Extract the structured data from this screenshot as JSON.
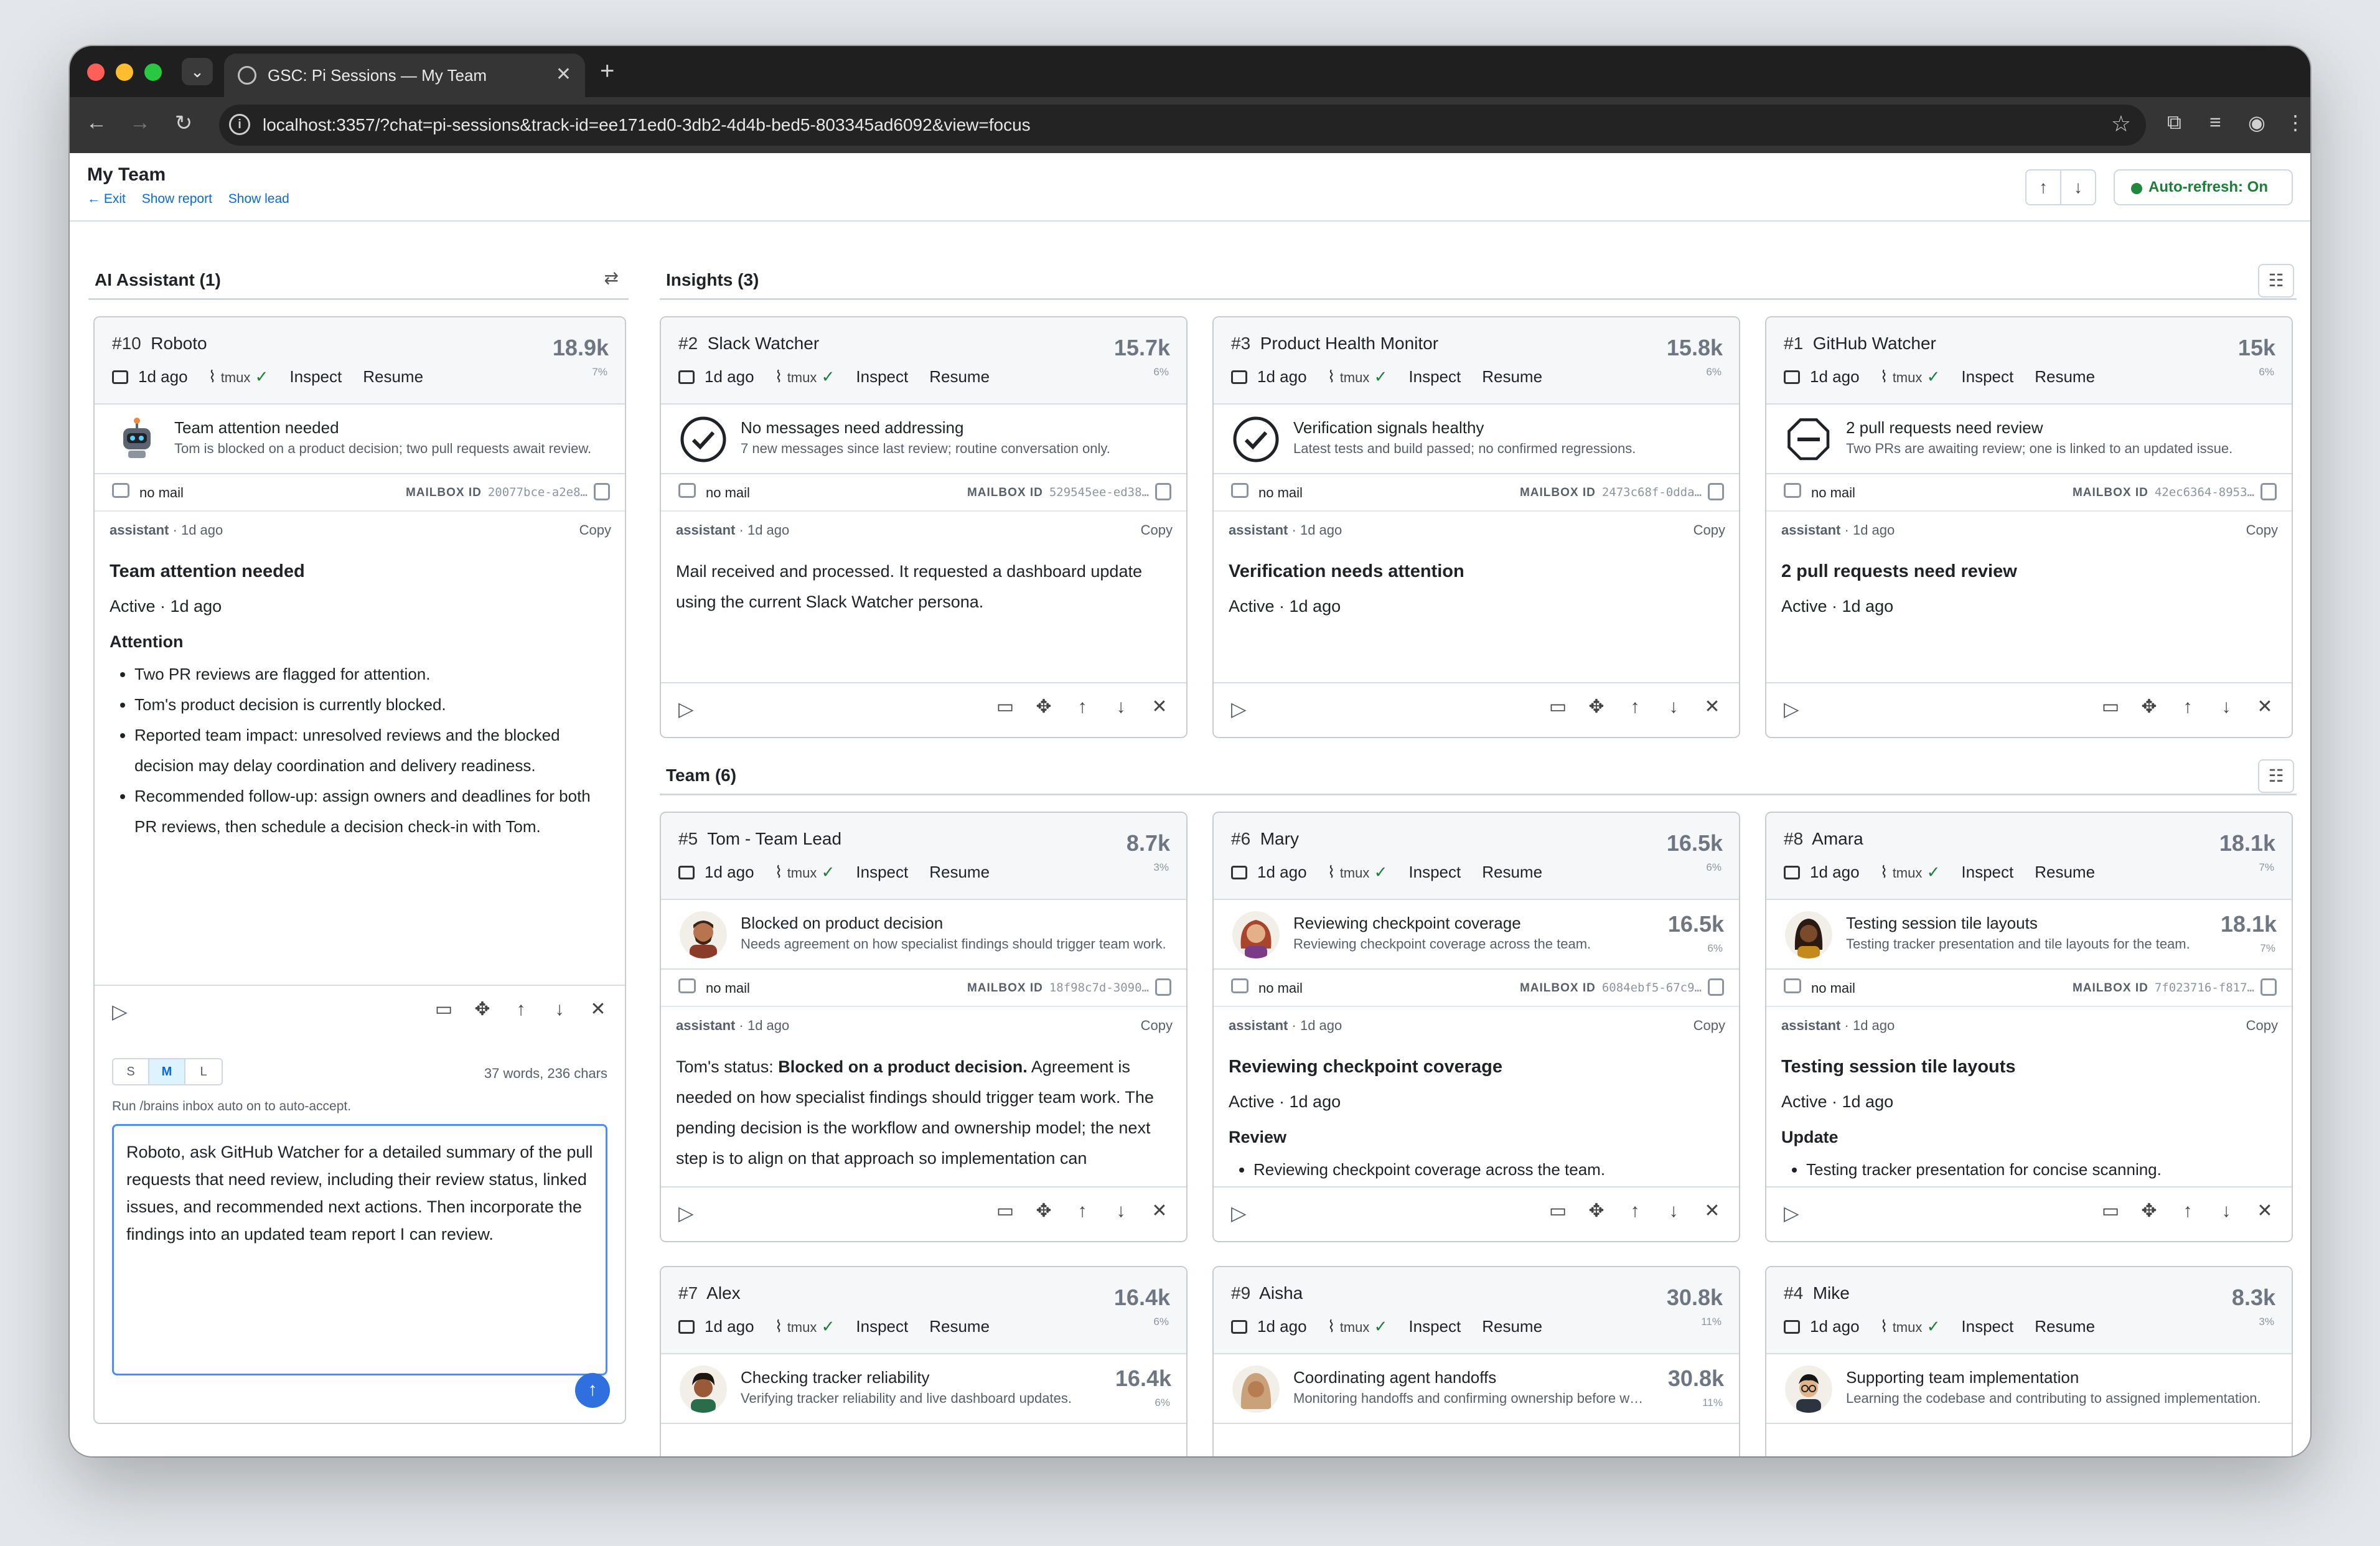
{
  "browser": {
    "tab_title": "GSC: Pi Sessions — My Team",
    "url": "localhost:3357/?chat=pi-sessions&track-id=ee171ed0-3db2-4d4b-bed5-803345ad6092&view=focus"
  },
  "page": {
    "title": "My Team",
    "links": [
      "← Exit",
      "Show report",
      "Show lead"
    ],
    "auto_refresh": "Auto-refresh: On"
  },
  "sections": {
    "assistant": "AI Assistant (1)",
    "insights": "Insights (3)",
    "team": "Team (6)"
  },
  "common": {
    "ago": "1d ago",
    "tmux": "tmux",
    "inspect": "Inspect",
    "resume": "Resume",
    "no_mail": "no mail",
    "mailbox_label": "MAILBOX ID",
    "assistant": "assistant",
    "assistant_ago": "· 1d ago",
    "copy": "Copy"
  },
  "cards": [
    {
      "num": "#10",
      "name": "Roboto",
      "tokens": "18.9k",
      "pct": "7%",
      "status_title": "Team attention needed",
      "status_sub": "Tom is blocked on a product decision; two pull requests await review.",
      "mailbox_id": "20077bce-a2e8…",
      "heading": "Team attention needed",
      "state": "Active · 1d ago",
      "section": "Attention",
      "bullets": [
        "Two PR reviews are flagged for attention.",
        "Tom's product decision is currently blocked.",
        "Reported team impact: unresolved reviews and the blocked decision may delay coordination and delivery readiness.",
        "Recommended follow-up: assign owners and deadlines for both PR reviews, then schedule a decision check-in with Tom."
      ]
    },
    {
      "num": "#2",
      "name": "Slack Watcher",
      "tokens": "15.7k",
      "pct": "6%",
      "status_title": "No messages need addressing",
      "status_sub": "7 new messages since last review; routine conversation only.",
      "mailbox_id": "529545ee-ed38…",
      "text": "Mail received and processed. It requested a dashboard update using the current Slack Watcher persona."
    },
    {
      "num": "#3",
      "name": "Product Health Monitor",
      "tokens": "15.8k",
      "pct": "6%",
      "status_title": "Verification signals healthy",
      "status_sub": "Latest tests and build passed; no confirmed regressions.",
      "mailbox_id": "2473c68f-0dda…",
      "heading": "Verification needs attention",
      "state": "Active · 1d ago"
    },
    {
      "num": "#1",
      "name": "GitHub Watcher",
      "tokens": "15k",
      "pct": "6%",
      "status_title": "2 pull requests need review",
      "status_sub": "Two PRs are awaiting review; one is linked to an updated issue.",
      "mailbox_id": "42ec6364-8953…",
      "heading": "2 pull requests need review",
      "state": "Active · 1d ago"
    },
    {
      "num": "#5",
      "name": "Tom - Team Lead",
      "tokens": "8.7k",
      "pct": "3%",
      "status_title": "Blocked on product decision",
      "status_sub": "Needs agreement on how specialist findings should trigger team work.",
      "mailbox_id": "18f98c7d-3090…",
      "text_prefix": "Tom's status: ",
      "text_bold": "Blocked on a product decision.",
      "text": " Agreement is needed on how specialist findings should trigger team work. The pending decision is the workflow and ownership model; the next step is to align on that approach so implementation can"
    },
    {
      "num": "#6",
      "name": "Mary",
      "tokens": "16.5k",
      "pct": "6%",
      "status_title": "Reviewing checkpoint coverage",
      "status_sub": "Reviewing checkpoint coverage across the team.",
      "status_tokens": "16.5k",
      "status_pct": "6%",
      "mailbox_id": "6084ebf5-67c9…",
      "heading": "Reviewing checkpoint coverage",
      "state": "Active · 1d ago",
      "section": "Review",
      "bullets": [
        "Reviewing checkpoint coverage across the team."
      ]
    },
    {
      "num": "#8",
      "name": "Amara",
      "tokens": "18.1k",
      "pct": "7%",
      "status_title": "Testing session tile layouts",
      "status_sub": "Testing tracker presentation and tile layouts for the team.",
      "status_tokens": "18.1k",
      "status_pct": "7%",
      "mailbox_id": "7f023716-f817…",
      "heading": "Testing session tile layouts",
      "state": "Active · 1d ago",
      "section": "Update",
      "bullets": [
        "Testing tracker presentation for concise scanning."
      ]
    },
    {
      "num": "#7",
      "name": "Alex",
      "tokens": "16.4k",
      "pct": "6%",
      "status_title": "Checking tracker reliability",
      "status_sub": "Verifying tracker reliability and live dashboard updates.",
      "status_tokens": "16.4k",
      "status_pct": "6%"
    },
    {
      "num": "#9",
      "name": "Aisha",
      "tokens": "30.8k",
      "pct": "11%",
      "status_title": "Coordinating agent handoffs",
      "status_sub": "Monitoring handoffs and confirming ownership before work begins.",
      "status_tokens": "30.8k",
      "status_pct": "11%"
    },
    {
      "num": "#4",
      "name": "Mike",
      "tokens": "8.3k",
      "pct": "3%",
      "status_title": "Supporting team implementation",
      "status_sub": "Learning the codebase and contributing to assigned implementation."
    }
  ],
  "composer": {
    "sizes": [
      "S",
      "M",
      "L"
    ],
    "selected": "M",
    "words": "37 words, 236 chars",
    "hint": "Run /brains inbox auto on to auto-accept.",
    "text": "Roboto, ask GitHub Watcher for a detailed summary of the pull requests that need review, including their review status, linked issues, and recommended next actions. Then incorporate the findings into an updated team report I can review."
  }
}
